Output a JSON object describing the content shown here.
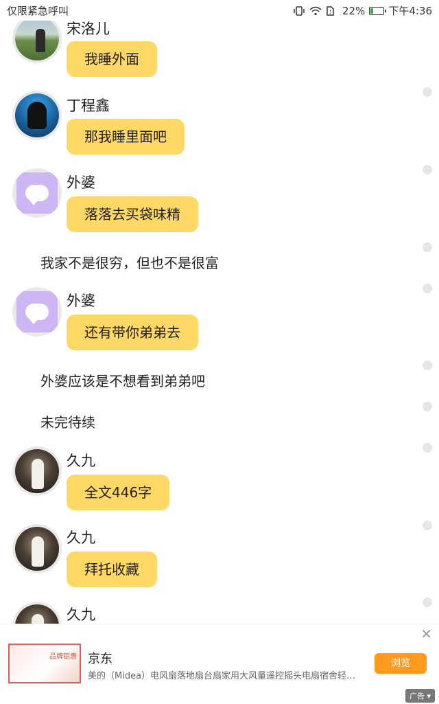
{
  "status_bar": {
    "left_text": "仅限紧急呼叫",
    "battery_percent": "22%",
    "battery_level": 0.22,
    "time": "下午4:36",
    "icons": [
      "vibrate-icon",
      "wifi-icon",
      "sim-icon",
      "battery-icon"
    ]
  },
  "messages": [
    {
      "type": "chat",
      "name": "宋洛儿",
      "text": "我睡外面",
      "avatar": "landscape-avatar"
    },
    {
      "type": "chat",
      "name": "丁程鑫",
      "text": "那我睡里面吧",
      "avatar": "portrait-avatar"
    },
    {
      "type": "chat",
      "name": "外婆",
      "text": "落落去买袋味精",
      "avatar": "chat-bubble-avatar"
    },
    {
      "type": "narration",
      "text": "我家不是很穷，但也不是很富"
    },
    {
      "type": "chat",
      "name": "外婆",
      "text": "还有带你弟弟去",
      "avatar": "chat-bubble-avatar"
    },
    {
      "type": "narration",
      "text": "外婆应该是不想看到弟弟吧"
    },
    {
      "type": "narration",
      "text": "未完待续"
    },
    {
      "type": "chat",
      "name": "久九",
      "text": "全文446字",
      "avatar": "dark-photo-avatar"
    },
    {
      "type": "chat",
      "name": "久九",
      "text": "拜托收藏",
      "avatar": "dark-photo-avatar"
    },
    {
      "type": "chat",
      "name": "久九",
      "text": "",
      "avatar": "dark-photo-avatar"
    }
  ],
  "ad": {
    "title": "京东",
    "description": "美的（Midea）电风扇落地扇台扇家用大风量遥控摇头电扇宿舍轻音低噪...",
    "button_label": "浏览",
    "tag": "广告",
    "thumb_text": "品牌钜惠",
    "close_glyph": "✕"
  }
}
